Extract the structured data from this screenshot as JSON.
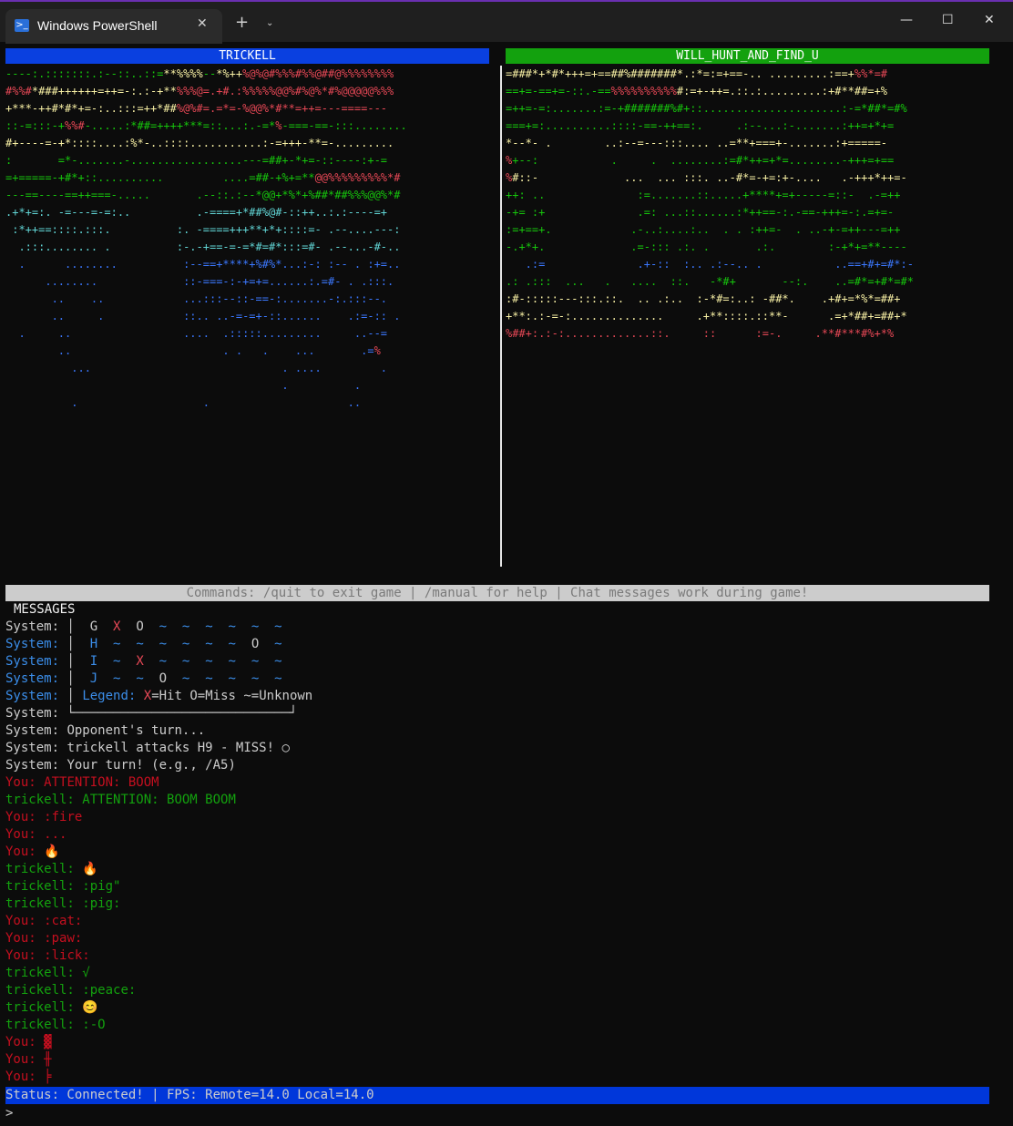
{
  "window": {
    "tab_title": "Windows PowerShell",
    "tab_icon": "powershell-icon",
    "close_tab_glyph": "✕",
    "new_tab_glyph": "+",
    "dropdown_glyph": "⌄",
    "minimize_glyph": "—",
    "maximize_glyph": "☐",
    "close_glyph": "✕"
  },
  "game": {
    "left_player": "TRICKELL",
    "right_player": "WILL_HUNT_AND_FIND_U"
  },
  "commands_bar": "Commands: /quit to exit game | /manual for help | Chat messages work during game!",
  "messages_title": "MESSAGES",
  "board_rows": [
    {
      "prefix": "System:",
      "row": "G",
      "cells": [
        "X",
        "O",
        "~",
        "~",
        "~",
        "~",
        "~",
        "~"
      ]
    },
    {
      "prefix": "System:",
      "row": "H",
      "cells": [
        "~",
        "~",
        "~",
        "~",
        "~",
        "~",
        "O",
        "~"
      ]
    },
    {
      "prefix": "System:",
      "row": "I",
      "cells": [
        "~",
        "X",
        "~",
        "~",
        "~",
        "~",
        "~",
        "~"
      ]
    },
    {
      "prefix": "System:",
      "row": "J",
      "cells": [
        "~",
        "~",
        "O",
        "~",
        "~",
        "~",
        "~",
        "~"
      ]
    }
  ],
  "legend": {
    "prefix": "System:",
    "label": "Legend:",
    "hit": "X",
    "hit_text": "=Hit",
    "miss_text": "O=Miss",
    "unknown_text": "~=Unknown"
  },
  "blank_system": "System:",
  "chat": [
    {
      "who": "sys",
      "speaker": "System:",
      "text": "Opponent's turn..."
    },
    {
      "who": "sys",
      "speaker": "System:",
      "text": "trickell attacks H9 - MISS! ○"
    },
    {
      "who": "sys",
      "speaker": "System:",
      "text": "Your turn! (e.g., /A5)"
    },
    {
      "who": "you",
      "speaker": "You:",
      "text": "ATTENTION: BOOM"
    },
    {
      "who": "trk",
      "speaker": "trickell:",
      "text": "ATTENTION: BOOM BOOM"
    },
    {
      "who": "you",
      "speaker": "You:",
      "text": ":fire"
    },
    {
      "who": "you",
      "speaker": "You:",
      "text": "..."
    },
    {
      "who": "you",
      "speaker": "You:",
      "text": "🔥"
    },
    {
      "who": "trk",
      "speaker": "trickell:",
      "text": "🔥"
    },
    {
      "who": "trk",
      "speaker": "trickell:",
      "text": ":pig\""
    },
    {
      "who": "trk",
      "speaker": "trickell:",
      "text": ":pig:"
    },
    {
      "who": "you",
      "speaker": "You:",
      "text": ":cat:"
    },
    {
      "who": "you",
      "speaker": "You:",
      "text": ":paw:"
    },
    {
      "who": "you",
      "speaker": "You:",
      "text": ":lick:"
    },
    {
      "who": "trk",
      "speaker": "trickell:",
      "text": "√"
    },
    {
      "who": "trk",
      "speaker": "trickell:",
      "text": ":peace:"
    },
    {
      "who": "trk",
      "speaker": "trickell:",
      "text": "😊"
    },
    {
      "who": "trk",
      "speaker": "trickell:",
      "text": ":-O"
    },
    {
      "who": "you",
      "speaker": "You:",
      "text": "▓"
    },
    {
      "who": "you",
      "speaker": "You:",
      "text": "╫"
    },
    {
      "who": "you",
      "speaker": "You:",
      "text": "╞"
    }
  ],
  "status": "Status: Connected! | FPS: Remote=14.0 Local=14.0",
  "prompt": ">",
  "colors": {
    "left_header": "#0a40e0",
    "right_header": "#13a10e",
    "status_bar": "#0037da",
    "you_text": "#c50f1f",
    "trickell_text": "#13a10e",
    "system_blue": "#3b8eea"
  }
}
